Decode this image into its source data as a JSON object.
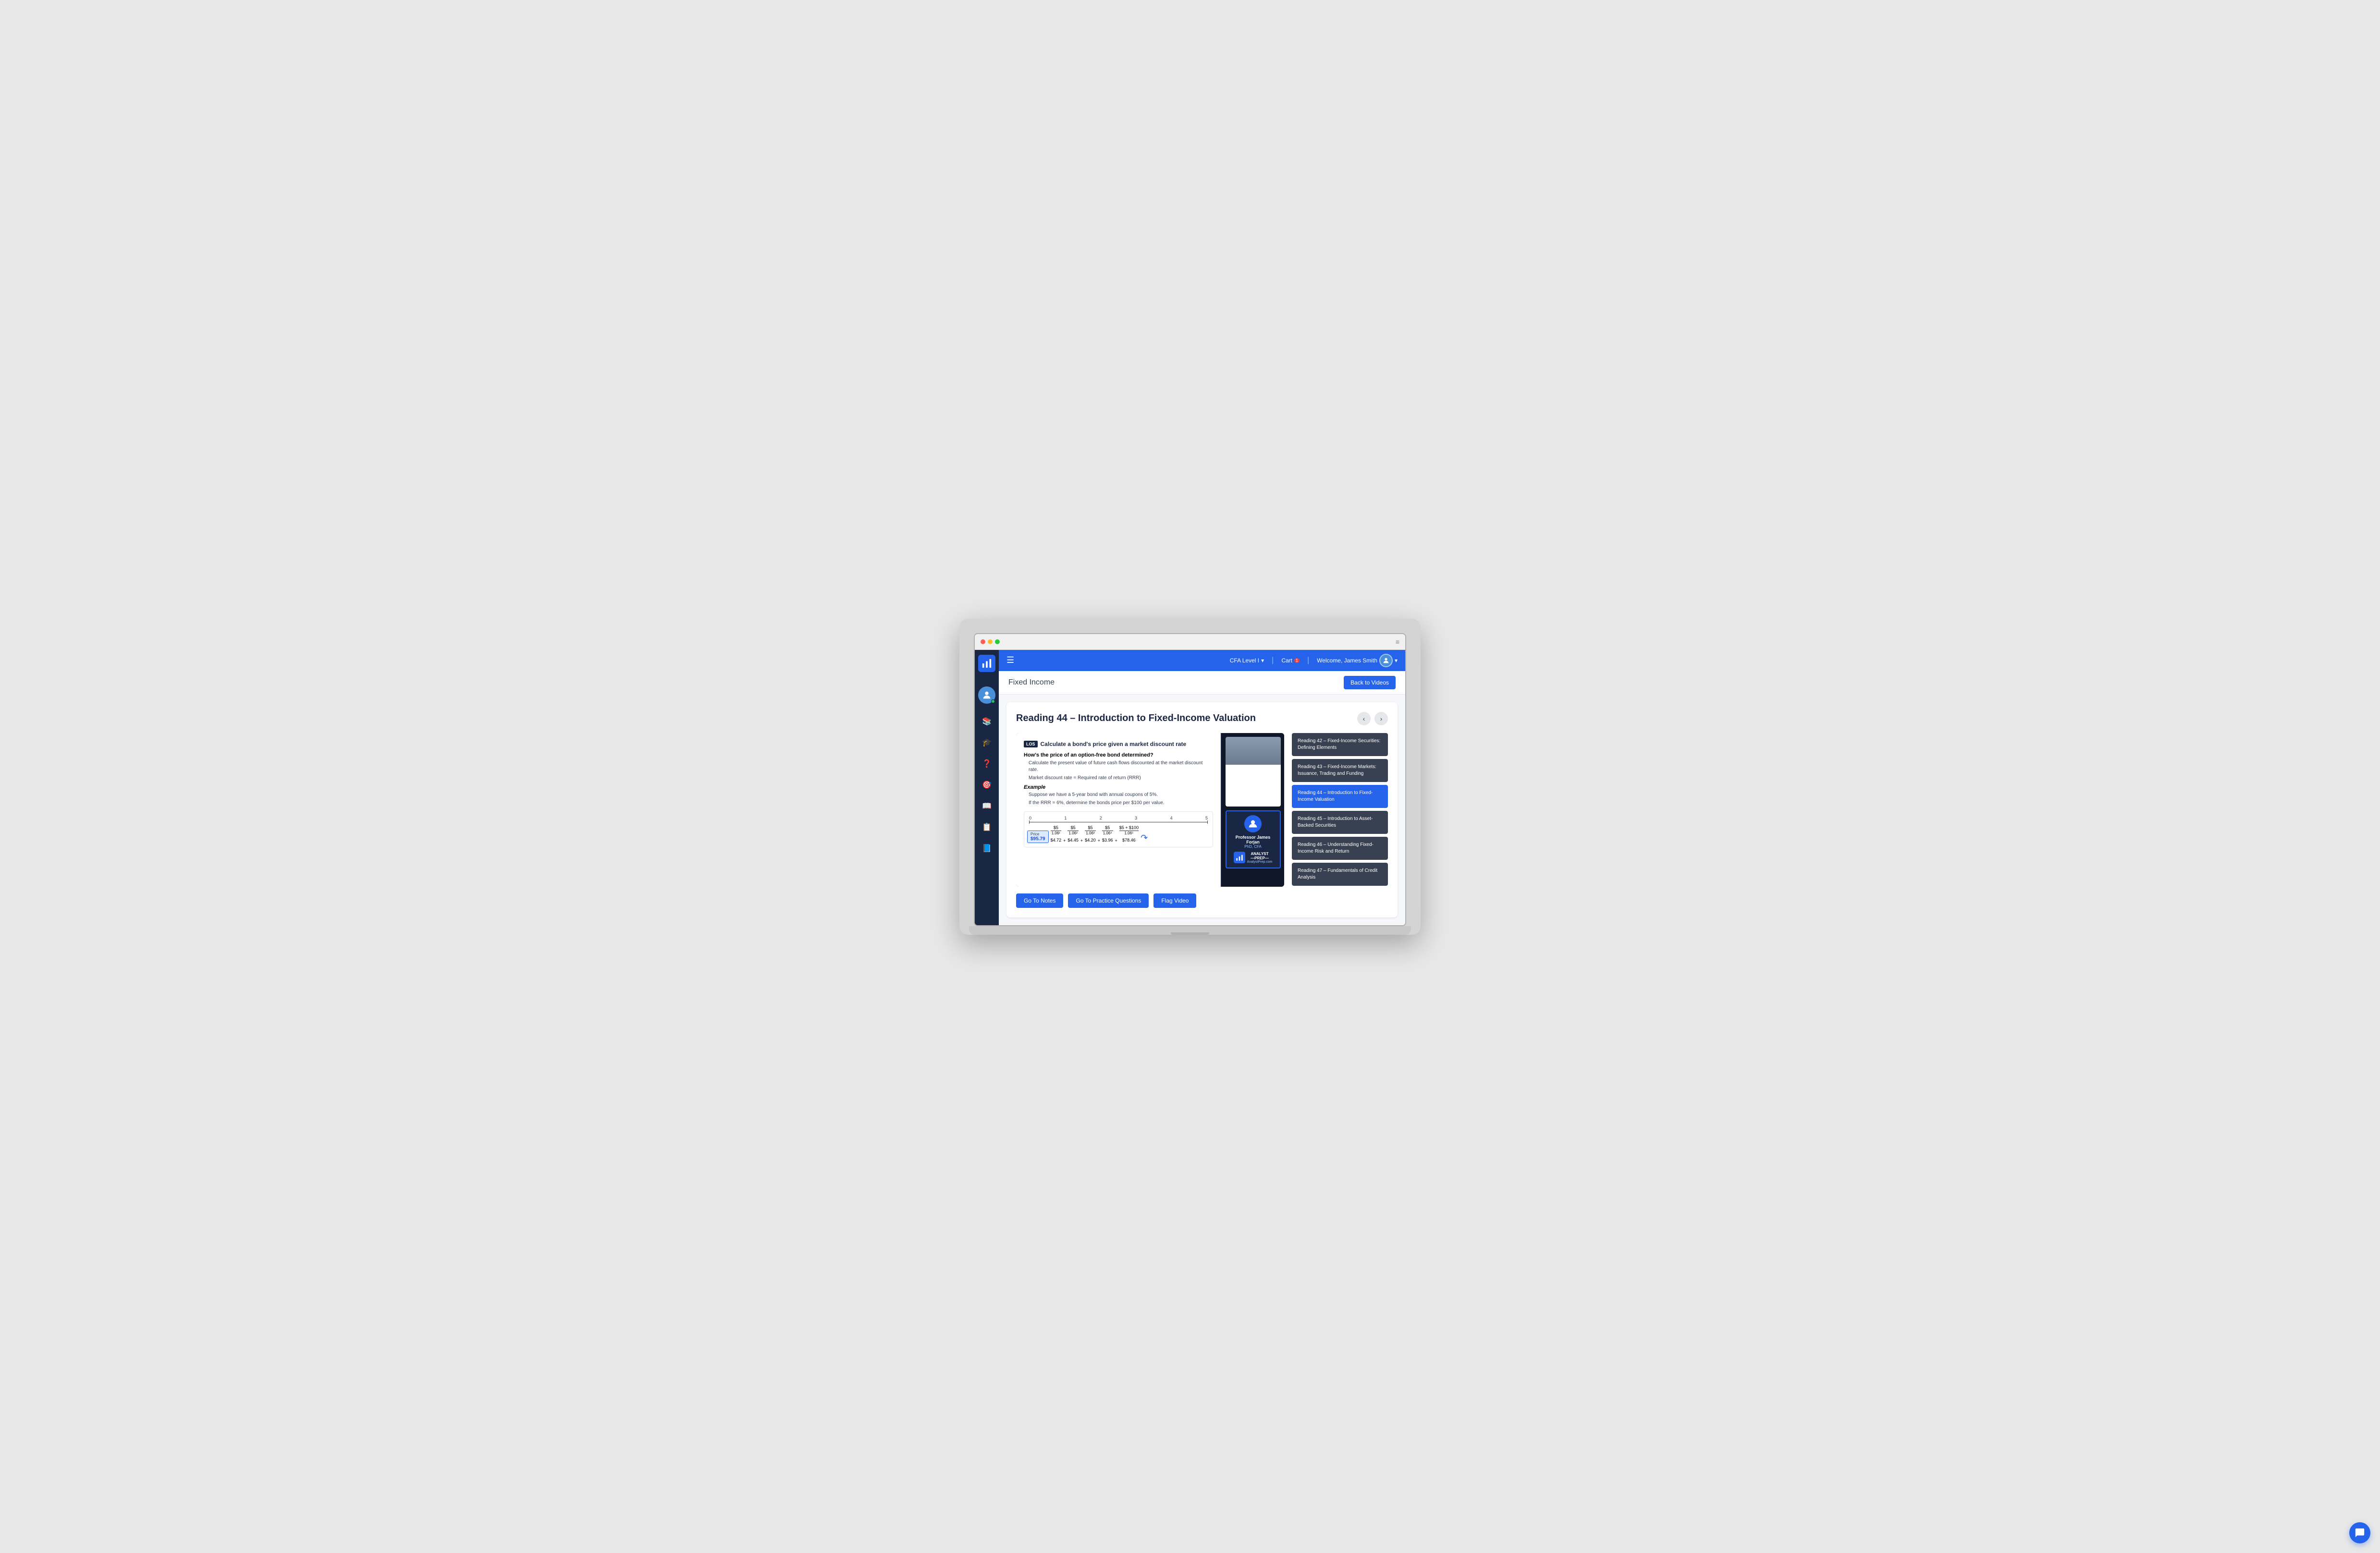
{
  "window": {
    "dots": [
      "red",
      "yellow",
      "green"
    ],
    "menu_icon": "≡"
  },
  "topnav": {
    "menu_icon": "☰",
    "course_label": "CFA Level I",
    "course_arrow": "▾",
    "cart_label": "Cart",
    "cart_count": "1",
    "welcome_label": "Welcome, James Smith",
    "user_arrow": "▾"
  },
  "page_header": {
    "title": "Fixed Income",
    "back_btn": "Back to Videos"
  },
  "reading": {
    "title": "Reading 44 – Introduction to Fixed-Income Valuation",
    "prev_arrow": "‹",
    "next_arrow": "›"
  },
  "slide": {
    "los_badge": "LOS",
    "heading": "Calculate a bond's price given a market discount rate",
    "subheading": "How's the price of an option-free bond determined?",
    "bullets": [
      "Calculate the present value of future cash flows discounted at the market discount rate.",
      "Market discount rate = Required rate of return (RRR)"
    ],
    "example_label": "Example",
    "example_bullets": [
      "Suppose we have a 5-year bond with annual coupons of 5%.",
      "If the RRR = 6%, determine the bonds price per $100 per value."
    ],
    "price_label": "Price",
    "price_value": "$95.79",
    "cashflows": [
      {
        "cf": "$5",
        "denom": "1.06¹",
        "result": "$4.72"
      },
      {
        "cf": "$5",
        "denom": "1.06²",
        "result": "$4.45"
      },
      {
        "cf": "$5",
        "denom": "1.06³",
        "result": "$4.20"
      },
      {
        "cf": "$5",
        "denom": "1.06⁴",
        "result": "$3.96"
      },
      {
        "cf": "$5 + $100",
        "denom": "1.06⁵",
        "result": "$78.46"
      }
    ],
    "timeline": [
      "0",
      "1",
      "2",
      "3",
      "4",
      "5"
    ]
  },
  "presenter": {
    "name": "Professor James Forjan",
    "title": "PhD, CFA",
    "logo_text": "ANALYST\n—PREP—",
    "url": "AnalystPrep.com"
  },
  "readings": [
    {
      "id": "r42",
      "label": "Reading 42 – Fixed-Income Securities: Defining Elements",
      "active": false
    },
    {
      "id": "r43",
      "label": "Reading 43 – Fixed-Income Markets: Issuance, Trading and Funding",
      "active": false
    },
    {
      "id": "r44",
      "label": "Reading 44 – Introduction to Fixed-Income Valuation",
      "active": true
    },
    {
      "id": "r45",
      "label": "Reading 45 – Introduction to Asset-Backed Securities",
      "active": false
    },
    {
      "id": "r46",
      "label": "Reading 46 – Understanding Fixed-Income Risk and Return",
      "active": false
    },
    {
      "id": "r47",
      "label": "Reading 47 – Fundamentals of Credit Analysis",
      "active": false
    }
  ],
  "actions": {
    "notes_btn": "Go To Notes",
    "practice_btn": "Go To Practice Questions",
    "flag_btn": "Flag Video"
  },
  "sidebar_icons": [
    "📚",
    "🎓",
    "❓",
    "🎯",
    "📖",
    "📋",
    "📘"
  ]
}
